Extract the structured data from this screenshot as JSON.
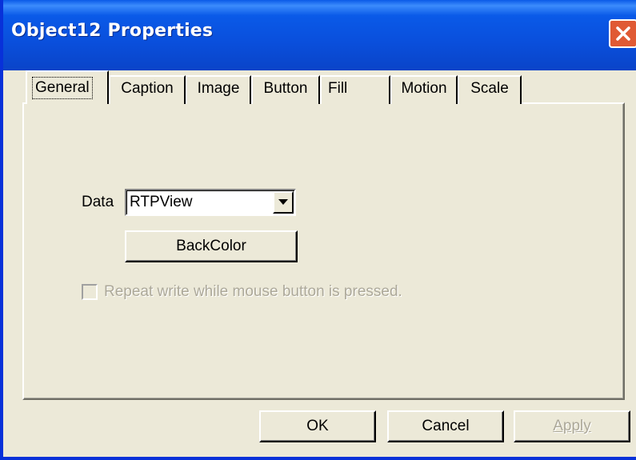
{
  "window": {
    "title": "Object12 Properties"
  },
  "tabs": [
    {
      "label": "General"
    },
    {
      "label": "Caption"
    },
    {
      "label": "Image"
    },
    {
      "label": "Button"
    },
    {
      "label": "Fill"
    },
    {
      "label": "Motion"
    },
    {
      "label": "Scale"
    }
  ],
  "active_tab": "General",
  "general": {
    "data_label": "Data",
    "data_value": "RTPView",
    "backcolor_label": "BackColor",
    "repeat_write_label": "Repeat write while mouse button is pressed.",
    "repeat_write_checked": false,
    "repeat_write_enabled": false
  },
  "buttons": {
    "ok": "OK",
    "cancel": "Cancel",
    "apply": "Apply"
  },
  "colors": {
    "titlebar": "#0a4fdc",
    "face": "#ece9d8",
    "close": "#e05a34",
    "disabled_text": "#aca899"
  },
  "icons": {
    "close": "close-icon",
    "dropdown": "chevron-down-icon"
  }
}
